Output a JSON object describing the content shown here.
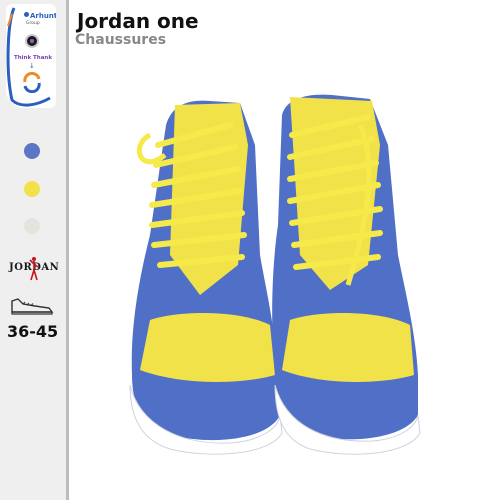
{
  "brand": {
    "company_name": "Arhunt",
    "company_sub": "Group",
    "think_text": "Think Thank"
  },
  "product": {
    "title": "Jordan one",
    "category": "Chaussures",
    "size_range": "36-45",
    "brand_logo_text": "JORDAN",
    "colors": [
      {
        "name": "blue",
        "hex": "#5b76c4"
      },
      {
        "name": "yellow",
        "hex": "#f2e24a"
      },
      {
        "name": "white",
        "hex": "#e2e4dd"
      }
    ]
  },
  "icons": {
    "shoe": "shoe-outline-icon",
    "jumpman": "jumpman-icon"
  }
}
